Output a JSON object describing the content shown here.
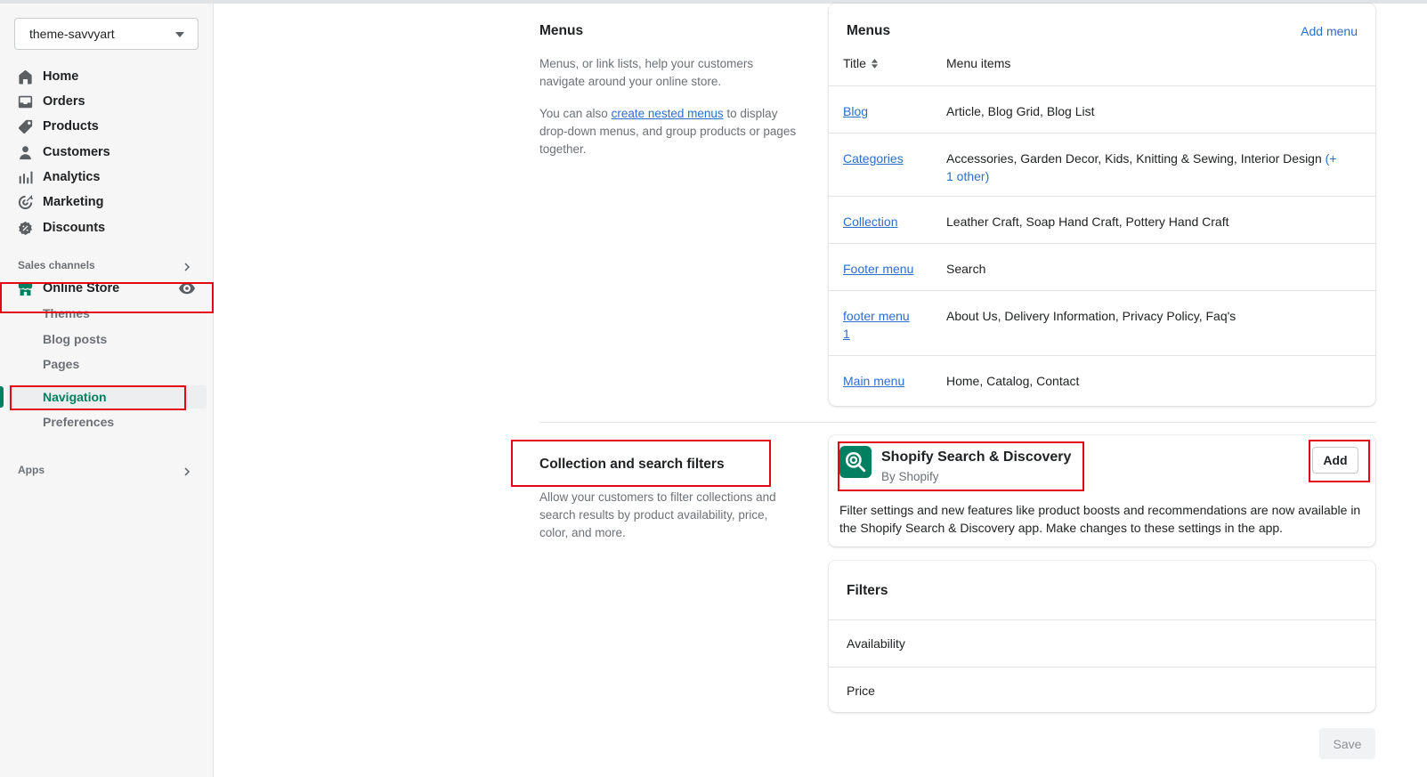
{
  "store_selector": {
    "value": "theme-savvyart"
  },
  "nav": {
    "home": "Home",
    "orders": "Orders",
    "products": "Products",
    "customers": "Customers",
    "analytics": "Analytics",
    "marketing": "Marketing",
    "discounts": "Discounts",
    "sales_channels_label": "Sales channels",
    "online_store": "Online Store",
    "sub_items": {
      "themes": "Themes",
      "blog_posts": "Blog posts",
      "pages": "Pages",
      "navigation": "Navigation",
      "preferences": "Preferences"
    },
    "apps_label": "Apps"
  },
  "menus_section": {
    "title": "Menus",
    "desc_1": "Menus, or link lists, help your customers navigate around your online store.",
    "desc_2_before": "You can also ",
    "desc_2_link": "create nested menus",
    "desc_2_after": " to display drop-down menus, and group products or pages together.",
    "card_title": "Menus",
    "add_menu": "Add menu",
    "col_title": "Title",
    "col_items": "Menu items",
    "rows": [
      {
        "title": "Blog",
        "items": "Article, Blog Grid, Blog List",
        "more": ""
      },
      {
        "title": "Categories",
        "items": "Accessories, Garden Decor, Kids, Knitting & Sewing, Interior Design",
        "more": "(+ 1 other)"
      },
      {
        "title": "Collection",
        "items": "Leather Craft, Soap Hand Craft, Pottery Hand Craft",
        "more": ""
      },
      {
        "title": "Footer menu",
        "items": "Search",
        "more": ""
      },
      {
        "title": "footer menu 1",
        "items": "About Us, Delivery Information, Privacy Policy, Faq's",
        "more": ""
      },
      {
        "title": "Main menu",
        "items": "Home, Catalog, Contact",
        "more": ""
      }
    ]
  },
  "filters_section": {
    "title": "Collection and search filters",
    "desc": "Allow your customers to filter collections and search results by product availability, price, color, and more.",
    "app_name": "Shopify Search & Discovery",
    "app_by": "By Shopify",
    "add_button": "Add",
    "app_desc": "Filter settings and new features like product boosts and recommendations are now available in the Shopify Search & Discovery app. Make changes to these settings in the app.",
    "filters_title": "Filters",
    "filters": [
      "Availability",
      "Price"
    ]
  },
  "save_button": "Save",
  "colors": {
    "accent_green": "#008060",
    "link_blue": "#2c6ecb",
    "highlight_red": "#e30613"
  }
}
